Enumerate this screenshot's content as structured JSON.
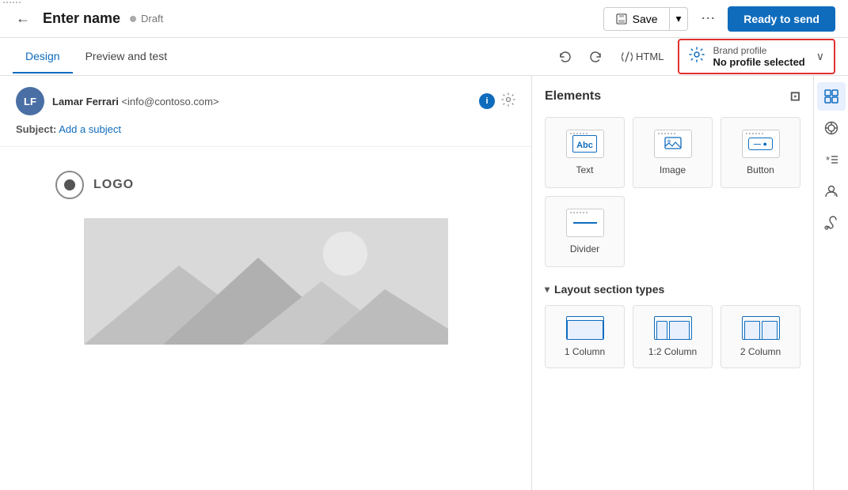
{
  "topBar": {
    "backIcon": "←",
    "title": "Enter name",
    "draftLabel": "Draft",
    "saveLabel": "Save",
    "moreIcon": "⋯",
    "readyLabel": "Ready to send"
  },
  "subNav": {
    "tabs": [
      {
        "id": "design",
        "label": "Design",
        "active": true
      },
      {
        "id": "preview",
        "label": "Preview and test",
        "active": false
      }
    ],
    "undoIcon": "↺",
    "redoIcon": "↻",
    "htmlLabel": "HTML",
    "brandProfile": {
      "label": "Brand profile",
      "value": "No profile selected",
      "chevron": "∨"
    }
  },
  "email": {
    "sender": {
      "initials": "LF",
      "name": "Lamar Ferrari",
      "email": "<info@contoso.com>"
    },
    "subject": {
      "label": "Subject:",
      "placeholder": "Add a subject"
    },
    "logo": {
      "text": "LOGO"
    }
  },
  "panel": {
    "title": "Elements",
    "expandIcon": "⊡",
    "elements": [
      {
        "id": "text",
        "label": "Text",
        "type": "text"
      },
      {
        "id": "image",
        "label": "Image",
        "type": "image"
      },
      {
        "id": "button",
        "label": "Button",
        "type": "button"
      },
      {
        "id": "divider",
        "label": "Divider",
        "type": "divider"
      }
    ],
    "layoutSection": {
      "title": "Layout section types",
      "chevron": "∨",
      "layouts": [
        {
          "id": "1col",
          "label": "1 Column"
        },
        {
          "id": "12col",
          "label": "1:2 Column"
        },
        {
          "id": "2col",
          "label": "2 Column"
        }
      ]
    }
  },
  "sideBar": {
    "icons": [
      {
        "id": "elements",
        "icon": "⊞",
        "active": true
      },
      {
        "id": "style",
        "icon": "◎",
        "active": false
      },
      {
        "id": "conditions",
        "icon": "*≡",
        "active": false
      },
      {
        "id": "personalize",
        "icon": "🖊",
        "active": false
      },
      {
        "id": "paint",
        "icon": "🖌",
        "active": false
      }
    ]
  }
}
